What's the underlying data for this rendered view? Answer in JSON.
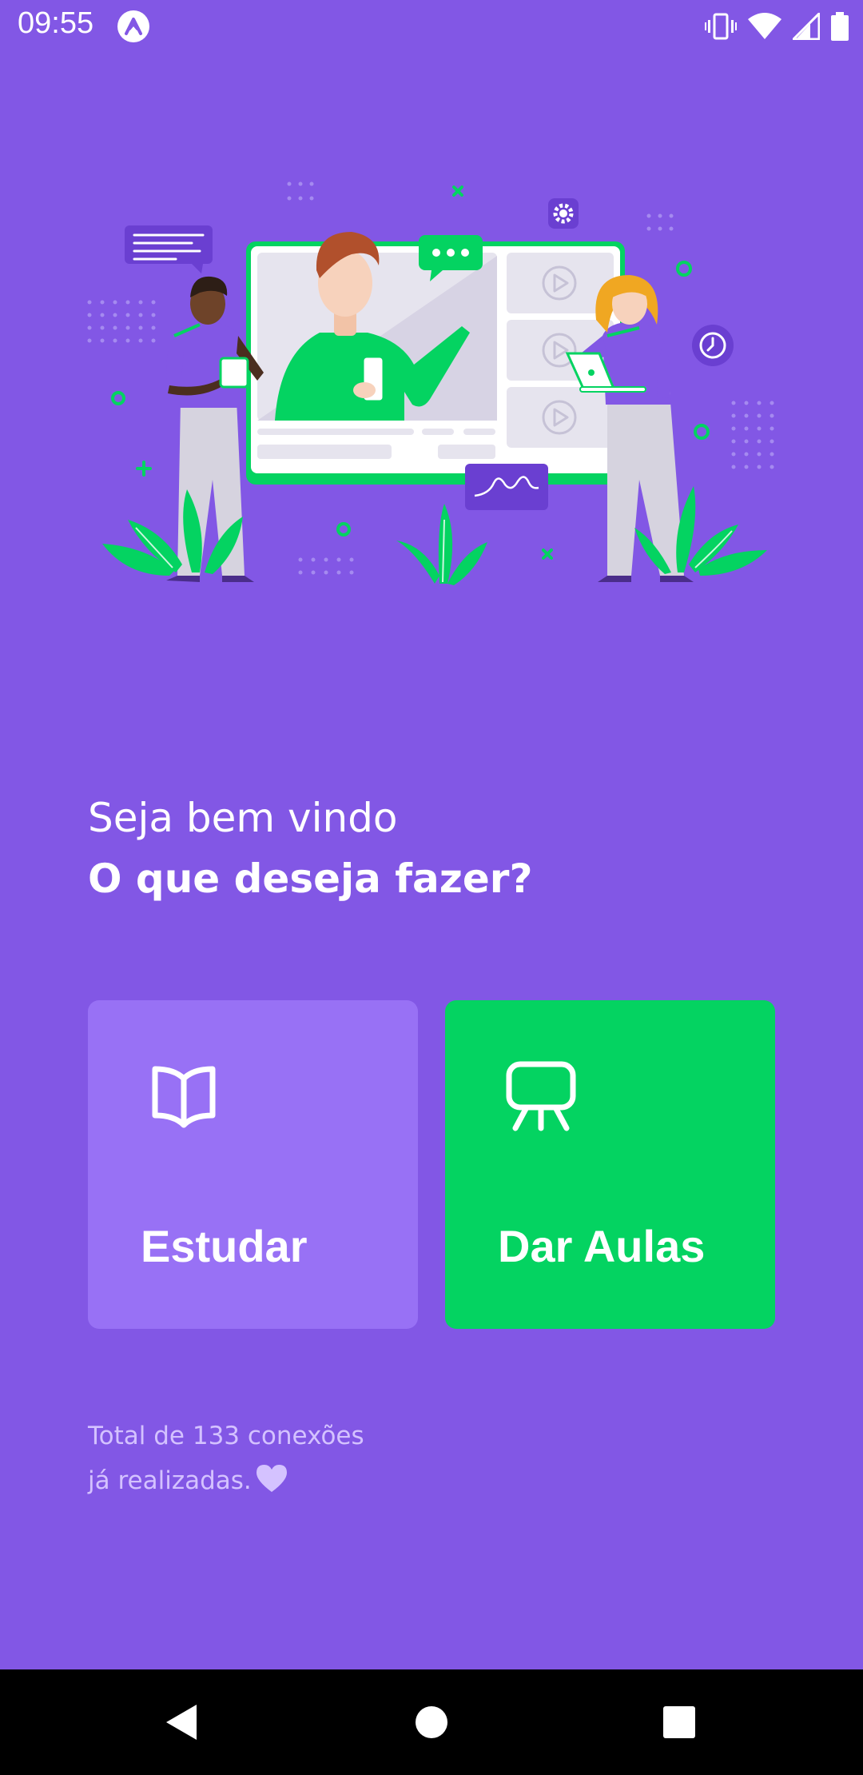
{
  "status_bar": {
    "time": "09:55",
    "app_icon": "expo-icon",
    "icons": [
      "vibrate-icon",
      "wifi-icon",
      "signal-icon",
      "battery-icon"
    ]
  },
  "hero": {
    "icon": "online-class-illustration"
  },
  "greeting": {
    "line1": "Seja bem vindo",
    "line2": "O que deseja fazer?"
  },
  "actions": {
    "study": {
      "label": "Estudar",
      "icon": "book-open-icon",
      "color": "#9871f5"
    },
    "teach": {
      "label": "Dar Aulas",
      "icon": "presentation-icon",
      "color": "#04d361"
    }
  },
  "connections": {
    "line1": "Total de 133 conexões",
    "line2": "já realizadas.",
    "icon": "heart-icon"
  },
  "navigation": {
    "icons": [
      "back-icon",
      "home-icon",
      "recents-icon"
    ]
  },
  "colors": {
    "background": "#8257e5",
    "primary_light": "#9871f5",
    "secondary": "#04d361",
    "muted_text": "#d4c2ff"
  }
}
